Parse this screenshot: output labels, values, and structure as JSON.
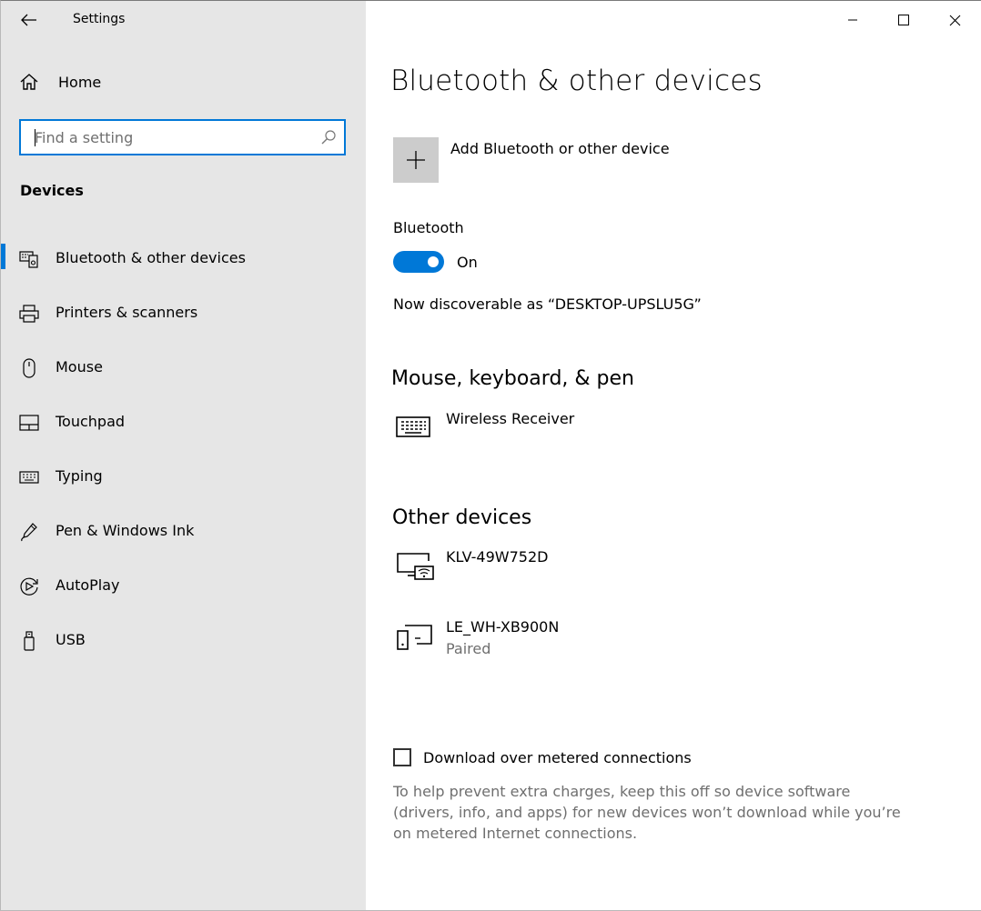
{
  "window": {
    "title": "Settings",
    "controls": [
      "minimize",
      "maximize",
      "close"
    ]
  },
  "sidebar": {
    "home_label": "Home",
    "search": {
      "value": "",
      "placeholder": "Find a setting"
    },
    "section_title": "Devices",
    "items": [
      {
        "label": "Bluetooth & other devices",
        "icon": "bluetooth-devices-icon",
        "selected": true
      },
      {
        "label": "Printers & scanners",
        "icon": "printer-icon",
        "selected": false
      },
      {
        "label": "Mouse",
        "icon": "mouse-icon",
        "selected": false
      },
      {
        "label": "Touchpad",
        "icon": "touchpad-icon",
        "selected": false
      },
      {
        "label": "Typing",
        "icon": "keyboard-icon",
        "selected": false
      },
      {
        "label": "Pen & Windows Ink",
        "icon": "pen-icon",
        "selected": false
      },
      {
        "label": "AutoPlay",
        "icon": "autoplay-icon",
        "selected": false
      },
      {
        "label": "USB",
        "icon": "usb-icon",
        "selected": false
      }
    ]
  },
  "main": {
    "title": "Bluetooth & other devices",
    "add_device_label": "Add Bluetooth or other device",
    "bluetooth": {
      "label": "Bluetooth",
      "state_label": "On",
      "enabled": true,
      "discoverable_text": "Now discoverable as “DESKTOP-UPSLU5G”"
    },
    "mouse_keyboard_pen": {
      "title": "Mouse, keyboard, & pen",
      "devices": [
        {
          "name": "Wireless Receiver",
          "status": "",
          "icon": "keyboard-icon"
        }
      ]
    },
    "other_devices": {
      "title": "Other devices",
      "devices": [
        {
          "name": "KLV-49W752D",
          "status": "",
          "icon": "display-wireless-icon"
        },
        {
          "name": "LE_WH-XB900N",
          "status": "Paired",
          "icon": "generic-device-icon"
        }
      ]
    },
    "metered": {
      "checked": false,
      "label": "Download over metered connections",
      "help": "To help prevent extra charges, keep this off so device software (drivers, info, and apps) for new devices won’t download while you’re on metered Internet connections."
    }
  },
  "colors": {
    "accent": "#0078d7",
    "sidebar_bg": "#e6e6e6",
    "secondary_text": "#6f6f6f",
    "add_button_bg": "#cccccc"
  }
}
